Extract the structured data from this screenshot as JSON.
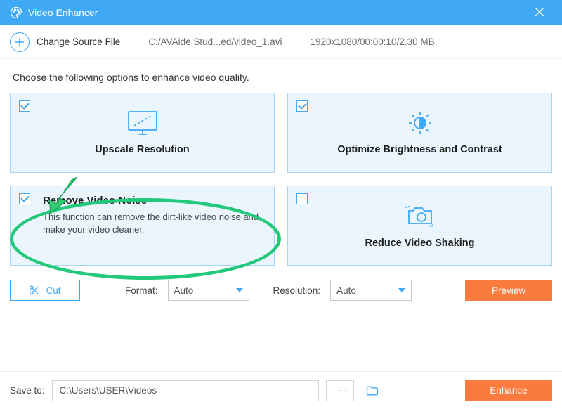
{
  "window": {
    "title": "Video Enhancer"
  },
  "toolbar": {
    "change_label": "Change Source File",
    "path": "C:/AVAide Stud...ed/video_1.avi",
    "info": "1920x1080/00:00:10/2.30 MB"
  },
  "instruction": "Choose the following options to enhance video quality.",
  "cards": {
    "upscale": {
      "label": "Upscale Resolution",
      "checked": true
    },
    "optimize": {
      "label": "Optimize Brightness and Contrast",
      "checked": true
    },
    "denoise": {
      "label": "Remove Video Noise",
      "checked": true,
      "desc": "This function can remove the dirt-like video noise and make your video cleaner."
    },
    "shake": {
      "label": "Reduce Video Shaking",
      "checked": false
    }
  },
  "controls": {
    "cut": "Cut",
    "format_label": "Format:",
    "format_value": "Auto",
    "resolution_label": "Resolution:",
    "resolution_value": "Auto",
    "preview": "Preview"
  },
  "save": {
    "label": "Save to:",
    "path": "C:\\Users\\USER\\Videos",
    "dots": "· · ·",
    "enhance": "Enhance"
  }
}
